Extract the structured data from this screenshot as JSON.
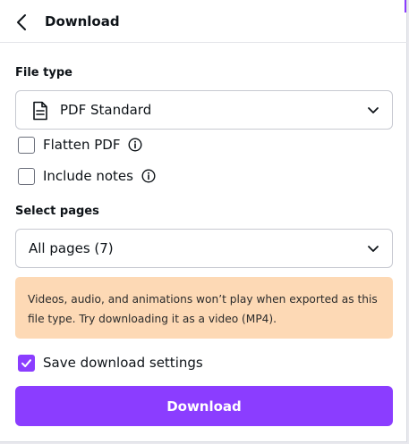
{
  "header": {
    "title": "Download"
  },
  "file_type": {
    "label": "File type",
    "selected": "PDF Standard",
    "icon": "document-icon"
  },
  "options": {
    "flatten_pdf": {
      "label": "Flatten PDF",
      "checked": false
    },
    "include_notes": {
      "label": "Include notes",
      "checked": false
    }
  },
  "pages": {
    "label": "Select pages",
    "selected": "All pages (7)"
  },
  "notice": {
    "text": "Videos, audio, and animations won’t play when exported as this file type. Try downloading it as a video (MP4)."
  },
  "save_settings": {
    "label": "Save download settings",
    "checked": true
  },
  "download_button": {
    "label": "Download"
  },
  "colors": {
    "accent": "#8b3dff",
    "notice_bg": "#fdd9b5"
  }
}
